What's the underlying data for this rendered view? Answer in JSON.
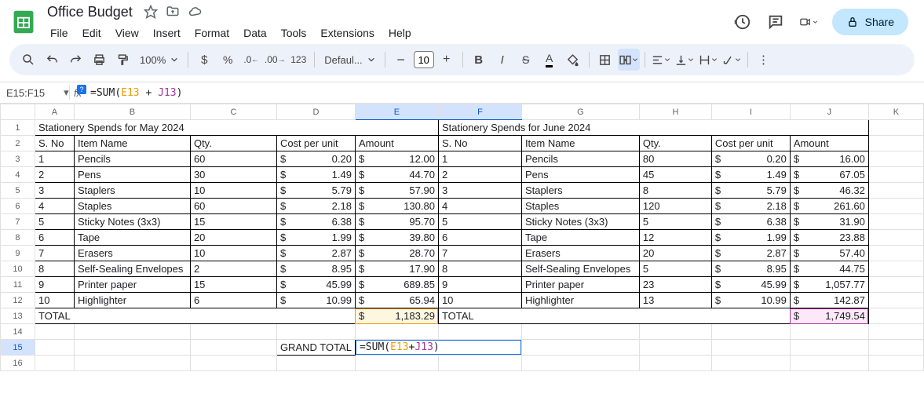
{
  "doc_title": "Office Budget",
  "menu": [
    "File",
    "Edit",
    "View",
    "Insert",
    "Format",
    "Data",
    "Tools",
    "Extensions",
    "Help"
  ],
  "share_label": "Share",
  "zoom": "100%",
  "font_name": "Defaul...",
  "font_size": "10",
  "namebox": "E15:F15",
  "formula": {
    "prefix": "=",
    "fn": "SUM",
    "open": "(",
    "ref1": "E13",
    "op": " + ",
    "ref2": "J13",
    "close": ")"
  },
  "headers": [
    "A",
    "B",
    "C",
    "D",
    "E",
    "F",
    "G",
    "H",
    "I",
    "J",
    "K"
  ],
  "row1": {
    "may_title": "Stationery Spends for May 2024",
    "june_title": "Stationery Spends for June 2024"
  },
  "row2": {
    "sno": "S. No",
    "item": "Item Name",
    "qty": "Qty.",
    "cpu": "Cost per unit",
    "amount": "Amount"
  },
  "may": [
    {
      "n": "1",
      "name": "Pencils",
      "qty": "60",
      "cpu": "0.20",
      "amt": "12.00"
    },
    {
      "n": "2",
      "name": "Pens",
      "qty": "30",
      "cpu": "1.49",
      "amt": "44.70"
    },
    {
      "n": "3",
      "name": "Staplers",
      "qty": "10",
      "cpu": "5.79",
      "amt": "57.90"
    },
    {
      "n": "4",
      "name": "Staples",
      "qty": "60",
      "cpu": "2.18",
      "amt": "130.80"
    },
    {
      "n": "5",
      "name": "Sticky Notes (3x3)",
      "qty": "15",
      "cpu": "6.38",
      "amt": "95.70"
    },
    {
      "n": "6",
      "name": "Tape",
      "qty": "20",
      "cpu": "1.99",
      "amt": "39.80"
    },
    {
      "n": "7",
      "name": "Erasers",
      "qty": "10",
      "cpu": "2.87",
      "amt": "28.70"
    },
    {
      "n": "8",
      "name": "Self-Sealing Envelopes",
      "qty": "2",
      "cpu": "8.95",
      "amt": "17.90"
    },
    {
      "n": "9",
      "name": "Printer paper",
      "qty": "15",
      "cpu": "45.99",
      "amt": "689.85"
    },
    {
      "n": "10",
      "name": "Highlighter",
      "qty": "6",
      "cpu": "10.99",
      "amt": "65.94"
    }
  ],
  "june": [
    {
      "n": "1",
      "name": "Pencils",
      "qty": "80",
      "cpu": "0.20",
      "amt": "16.00"
    },
    {
      "n": "2",
      "name": "Pens",
      "qty": "45",
      "cpu": "1.49",
      "amt": "67.05"
    },
    {
      "n": "3",
      "name": "Staplers",
      "qty": "8",
      "cpu": "5.79",
      "amt": "46.32"
    },
    {
      "n": "4",
      "name": "Staples",
      "qty": "120",
      "cpu": "2.18",
      "amt": "261.60"
    },
    {
      "n": "5",
      "name": "Sticky Notes (3x3)",
      "qty": "5",
      "cpu": "6.38",
      "amt": "31.90"
    },
    {
      "n": "6",
      "name": "Tape",
      "qty": "12",
      "cpu": "1.99",
      "amt": "23.88"
    },
    {
      "n": "7",
      "name": "Erasers",
      "qty": "20",
      "cpu": "2.87",
      "amt": "57.40"
    },
    {
      "n": "8",
      "name": "Self-Sealing Envelopes",
      "qty": "5",
      "cpu": "8.95",
      "amt": "44.75"
    },
    {
      "n": "9",
      "name": "Printer paper",
      "qty": "23",
      "cpu": "45.99",
      "amt": "1,057.77"
    },
    {
      "n": "10",
      "name": "Highlighter",
      "qty": "13",
      "cpu": "10.99",
      "amt": "142.87"
    }
  ],
  "total_label": "TOTAL",
  "may_total": "1,183.29",
  "june_total": "1,749.54",
  "grand_total_label": "GRAND TOTAL",
  "currency": "$"
}
